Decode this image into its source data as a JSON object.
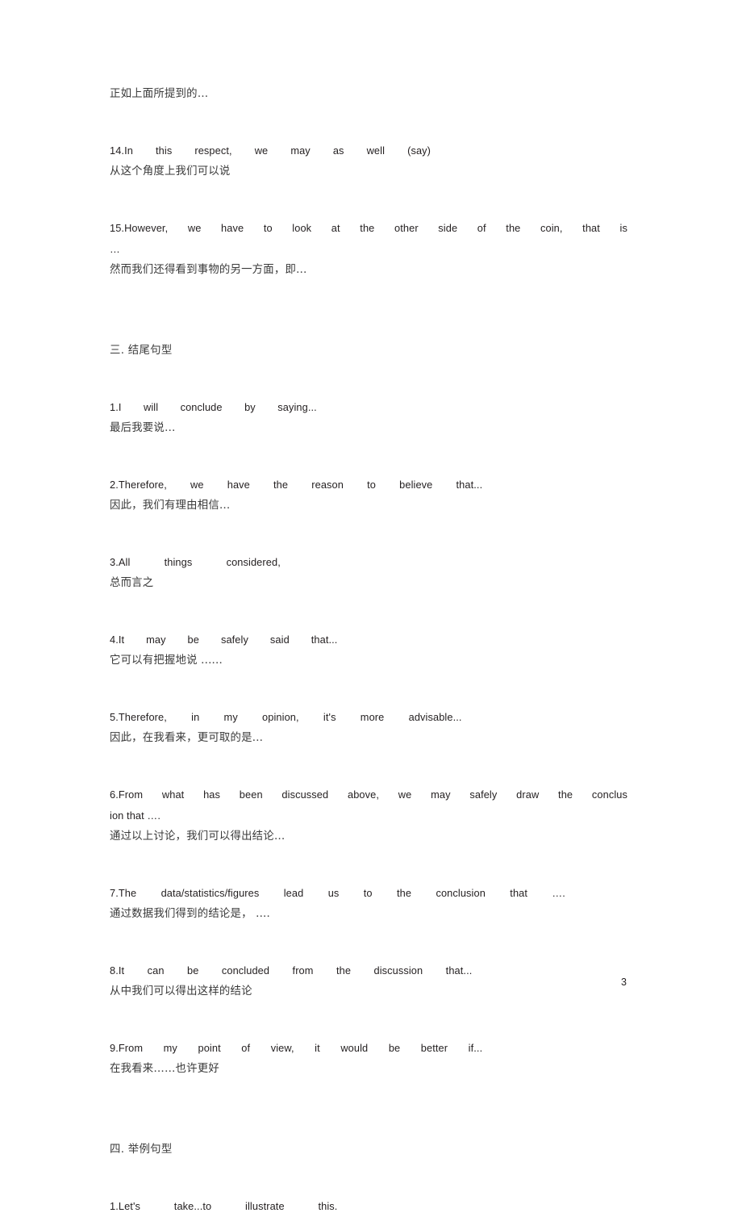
{
  "document": {
    "page_number": "3",
    "top_fragment_cn": "正如上面所提到的…"
  },
  "carryover_items": [
    {
      "en": "14.In this respect, we may as well (say)",
      "cn": "从这个角度上我们可以说"
    },
    {
      "en": "15.However, we have to look at the other side of the coin, that is",
      "en_cont": "…",
      "cn": "然而我们还得看到事物的另一方面，即…"
    }
  ],
  "sections": [
    {
      "heading": "三. 结尾句型",
      "items": [
        {
          "en": "1.I will conclude by saying...",
          "cn": "最后我要说…"
        },
        {
          "en": "2.Therefore, we have the reason to believe that...",
          "cn": "因此，我们有理由相信…"
        },
        {
          "en": "3.All things considered,",
          "cn": "总而言之"
        },
        {
          "en": "4.It may be safely said that...",
          "cn": "它可以有把握地说  ......"
        },
        {
          "en": "5.Therefore, in my opinion, it's more advisable...",
          "cn": "因此，在我看来，更可取的是…"
        },
        {
          "en": "6.From what has been discussed above, we may safely draw the conclus",
          "en_cont": "ion that ….",
          "cn": "通过以上讨论，我们可以得出结论…"
        },
        {
          "en": "7.The data/statistics/figures lead us to the conclusion that ….",
          "cn": "通过数据我们得到的结论是，   ...."
        },
        {
          "en": "8.It can be concluded from the discussion that...",
          "cn": "从中我们可以得出这样的结论"
        },
        {
          "en": "9.From my point of view, it would be better if...",
          "cn": "在我看来……也许更好"
        }
      ]
    },
    {
      "heading": "四. 举例句型",
      "items": [
        {
          "en": "1.Let's take...to illustrate this.",
          "cn": ""
        }
      ]
    }
  ],
  "colors": {
    "page_background": "#ffffff",
    "body_text": "#231f20",
    "translation_text": "#3a3a3a"
  }
}
